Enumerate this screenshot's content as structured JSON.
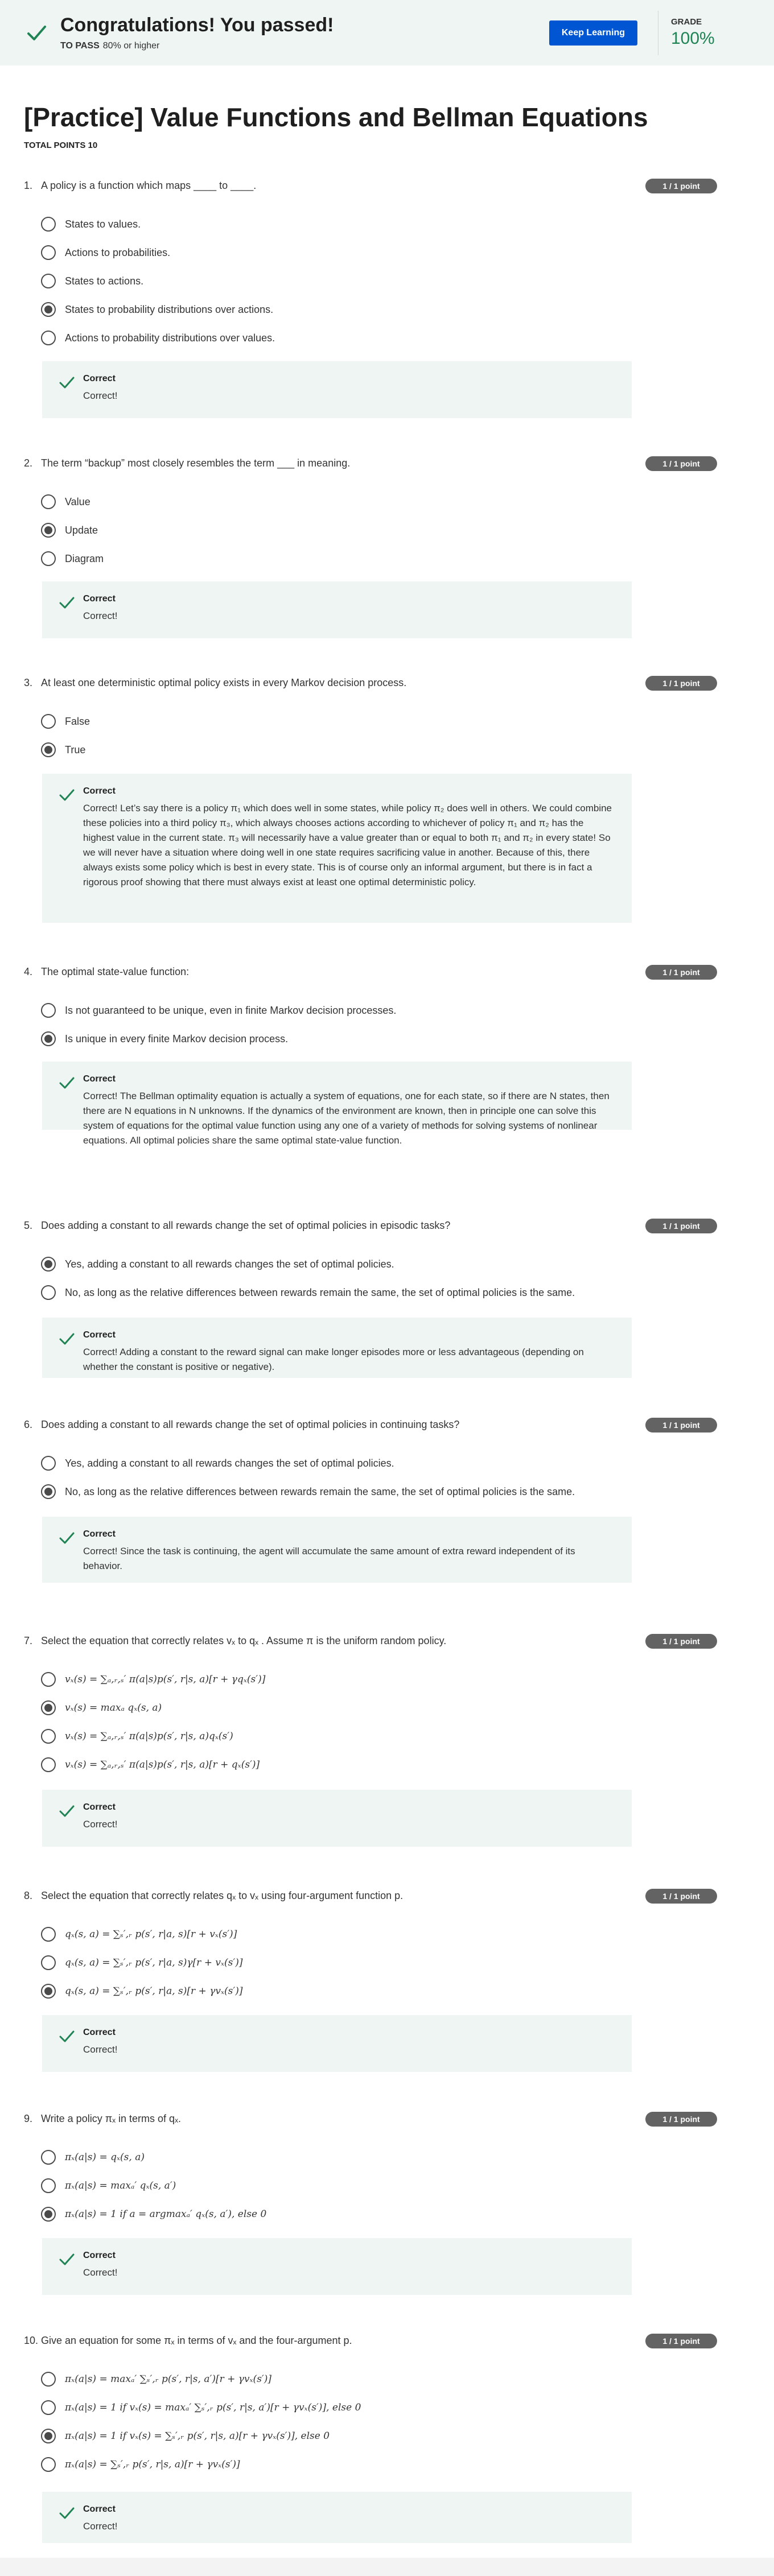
{
  "banner": {
    "title": "Congratulations! You passed!",
    "to_pass_label": "TO PASS",
    "to_pass_value": "80% or higher",
    "keep_learning": "Keep Learning",
    "grade_label": "GRADE",
    "grade_value": "100%"
  },
  "page": {
    "title": "[Practice] Value Functions and Bellman Equations",
    "total_points": "TOTAL POINTS 10"
  },
  "questions": [
    {
      "number": "1.",
      "text": "A policy is a function which maps ____ to ____.",
      "points": "1 / 1 point",
      "options": [
        "States to values.",
        "Actions to probabilities.",
        "States to actions.",
        "States to probability distributions over actions.",
        "Actions to probability distributions over values."
      ],
      "selected": 3,
      "feedback_title": "Correct",
      "feedback": "Correct!"
    },
    {
      "number": "2.",
      "text": "The term “backup” most closely resembles the term ___ in meaning.",
      "points": "1 / 1 point",
      "options": [
        "Value",
        "Update",
        "Diagram"
      ],
      "selected": 1,
      "feedback_title": "Correct",
      "feedback": "Correct!"
    },
    {
      "number": "3.",
      "text": "At least one deterministic optimal policy exists in every Markov decision process.",
      "points": "1 / 1 point",
      "options": [
        "False",
        "True"
      ],
      "selected": 1,
      "feedback_title": "Correct",
      "feedback": "Correct! Let’s say there is a policy π₁ which does well in some states, while policy π₂ does well in others. We could combine these policies into a third policy π₃, which always chooses actions according to whichever of policy π₁ and π₂ has the highest value in the current state. π₃ will necessarily have a value greater than or equal to both π₁ and π₂ in every state! So we will never have a situation where doing well in one state requires sacrificing value in another. Because of this, there always exists some policy which is best in every state. This is of course only an informal argument, but there is in fact a rigorous proof showing that there must always exist at least one optimal deterministic policy."
    },
    {
      "number": "4.",
      "text": "The optimal state-value function:",
      "points": "1 / 1 point",
      "options": [
        "Is not guaranteed to be unique, even in finite Markov decision processes.",
        "Is unique in every finite Markov decision process."
      ],
      "selected": 1,
      "feedback_title": "Correct",
      "feedback": "Correct! The Bellman optimality equation is actually a system of equations, one for each state, so if there are N states, then there are N equations in N unknowns. If the dynamics of the environment are known, then in principle one can solve this system of equations for the optimal value function using any one of a variety of methods for solving systems of nonlinear equations. All optimal policies share the same optimal state-value function."
    },
    {
      "number": "5.",
      "text": "Does adding a constant to all rewards change the set of optimal policies in episodic tasks?",
      "points": "1 / 1 point",
      "options": [
        "Yes, adding a constant to all rewards changes the set of optimal policies.",
        "No, as long as the relative differences between rewards remain the same, the set of optimal policies is the same."
      ],
      "selected": 0,
      "feedback_title": "Correct",
      "feedback": "Correct! Adding a constant to the reward signal can make longer episodes more or less advantageous (depending on whether the constant is positive or negative)."
    },
    {
      "number": "6.",
      "text": "Does adding a constant to all rewards change the set of optimal policies in continuing tasks?",
      "points": "1 / 1 point",
      "options": [
        "Yes, adding a constant to all rewards changes the set of optimal policies.",
        "No, as long as the relative differences between rewards remain the same, the set of optimal policies is the same."
      ],
      "selected": 1,
      "feedback_title": "Correct",
      "feedback": "Correct! Since the task is continuing, the agent will accumulate the same amount of extra reward independent of its behavior."
    },
    {
      "number": "7.",
      "text": "Select the equation that correctly relates vₓ to qₓ . Assume π is the uniform random policy.",
      "points": "1 / 1 point",
      "options": [
        "vₓ(s) = ∑ₐ,ᵣ,ₛ′ π(a|s)p(s′, r|s, a)[r + γqₓ(s′)]",
        "vₓ(s) = maxₐ qₓ(s, a)",
        "vₓ(s) = ∑ₐ,ᵣ,ₛ′ π(a|s)p(s′, r|s, a)qₓ(s′)",
        "vₓ(s) = ∑ₐ,ᵣ,ₛ′ π(a|s)p(s′, r|s, a)[r + qₓ(s′)]"
      ],
      "selected": 1,
      "feedback_title": "Correct",
      "feedback": "Correct!"
    },
    {
      "number": "8.",
      "text": "Select the equation that correctly relates qₓ to vₓ using four-argument function p.",
      "points": "1 / 1 point",
      "options": [
        "qₓ(s, a) = ∑ₛ′,ᵣ p(s′, r|a, s)[r + vₓ(s′)]",
        "qₓ(s, a) = ∑ₛ′,ᵣ p(s′, r|a, s)γ[r + vₓ(s′)]",
        "qₓ(s, a) = ∑ₛ′,ᵣ p(s′, r|a, s)[r + γvₓ(s′)]"
      ],
      "selected": 2,
      "feedback_title": "Correct",
      "feedback": "Correct!"
    },
    {
      "number": "9.",
      "text": "Write a policy πₓ in terms of qₓ.",
      "points": "1 / 1 point",
      "options": [
        "πₓ(a|s) = qₓ(s, a)",
        "πₓ(a|s) = maxₐ′ qₓ(s, a′)",
        "πₓ(a|s) = 1 if a = argmaxₐ′ qₓ(s, a′), else 0"
      ],
      "selected": 2,
      "feedback_title": "Correct",
      "feedback": "Correct!"
    },
    {
      "number": "10.",
      "text": "Give an equation for some πₓ in terms of vₓ and the four-argument p.",
      "points": "1 / 1 point",
      "options": [
        "πₓ(a|s) = maxₐ′ ∑ₛ′,ᵣ p(s′, r|s, a′)[r + γvₓ(s′)]",
        "πₓ(a|s) = 1 if vₓ(s) = maxₐ′ ∑ₛ′,ᵣ p(s′, r|s, a′)[r + γvₓ(s′)], else 0",
        "πₓ(a|s) = 1 if vₓ(s) = ∑ₛ′,ᵣ p(s′, r|s, a)[r + γvₓ(s′)], else 0",
        "πₓ(a|s) = ∑ₛ′,ᵣ p(s′, r|s, a)[r + γvₓ(s′)]"
      ],
      "selected": 2,
      "feedback_title": "Correct",
      "feedback": "Correct!"
    }
  ]
}
